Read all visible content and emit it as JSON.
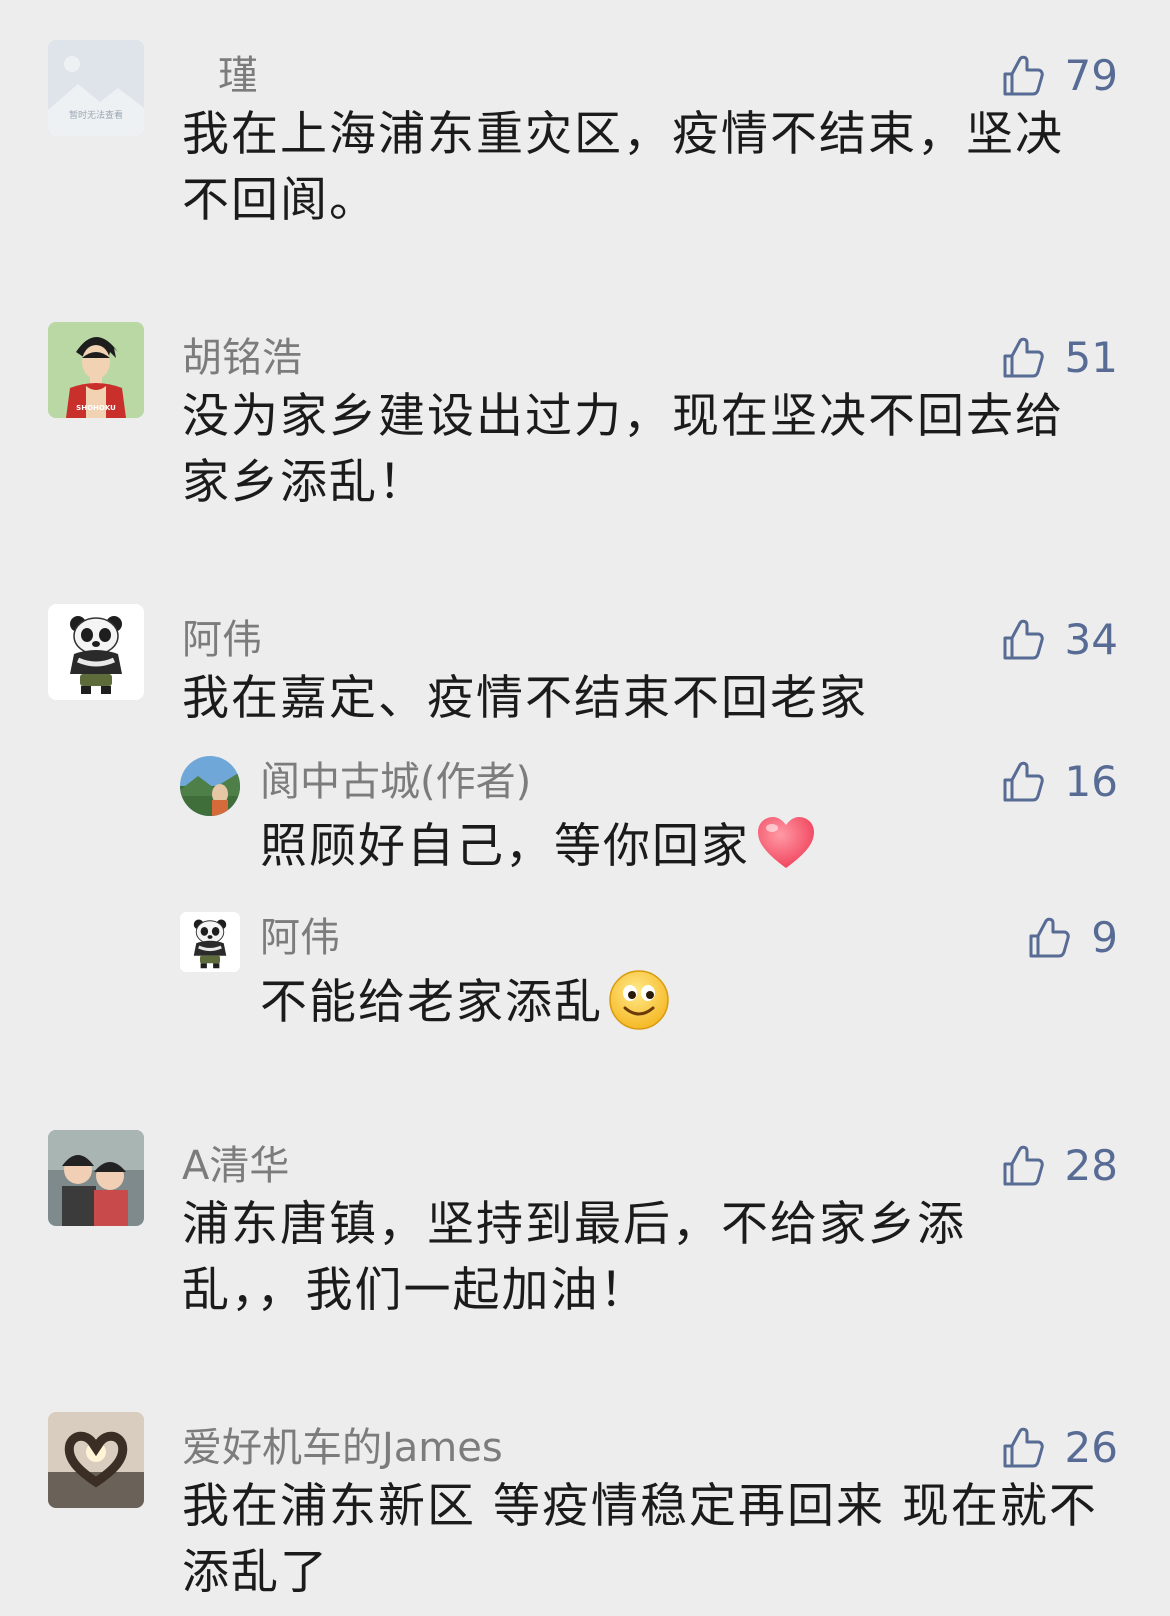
{
  "comments": [
    {
      "name": "瑾",
      "likes": "79",
      "text": "我在上海浦东重灾区，疫情不结束，坚决不回阆。",
      "avatar_caption": "暂时无法查看"
    },
    {
      "name": "胡铭浩",
      "likes": "51",
      "text": "没为家乡建设出过力，现在坚决不回去给家乡添乱！",
      "jersey": "SHOHOKU"
    },
    {
      "name": "阿伟",
      "likes": "34",
      "text": "我在嘉定、疫情不结束不回老家"
    },
    {
      "name": "A清华",
      "likes": "28",
      "text": "浦东唐镇，坚持到最后，不给家乡添乱，，我们一起加油！"
    },
    {
      "name": "爱好机车的James",
      "likes": "26",
      "text": "我在浦东新区 等疫情稳定再回来 现在就不添乱了"
    }
  ],
  "replies": [
    {
      "name": "阆中古城(作者)",
      "likes": "16",
      "text": "照顾好自己，等你回家",
      "emoji": "heart-emoji"
    },
    {
      "name": "阿伟",
      "likes": "9",
      "text": "不能给老家添乱",
      "emoji": "smile-emoji"
    }
  ],
  "colors": {
    "background": "#ededed",
    "like": "#576b95",
    "name": "#7c7c7c",
    "text": "#1b1b1b"
  }
}
